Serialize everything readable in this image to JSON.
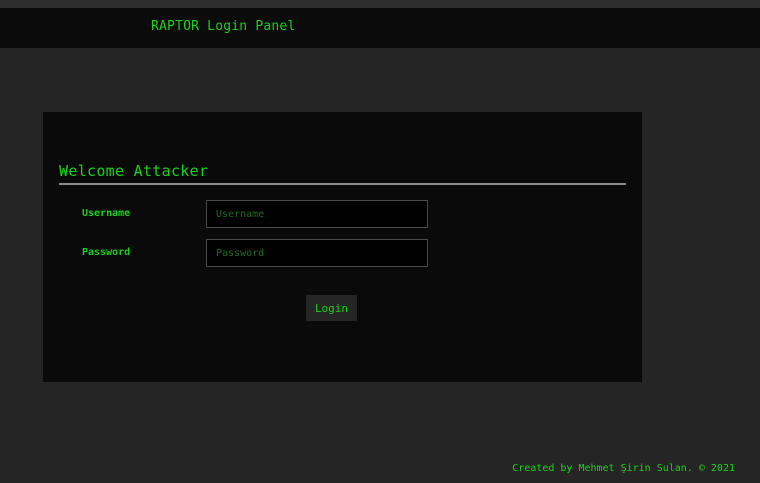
{
  "header": {
    "title": "RAPTOR Login Panel"
  },
  "panel": {
    "heading": "Welcome Attacker",
    "username": {
      "label": "Username",
      "placeholder": "Username",
      "value": ""
    },
    "password": {
      "label": "Password",
      "placeholder": "Password",
      "value": ""
    },
    "login_label": "Login"
  },
  "footer": {
    "credit": "Created by Mehmet Şirin Sulan. © 2021"
  },
  "colors": {
    "accent": "#19d319",
    "background": "#252525",
    "panel": "#0a0a0a",
    "header": "#0b0b0b"
  }
}
